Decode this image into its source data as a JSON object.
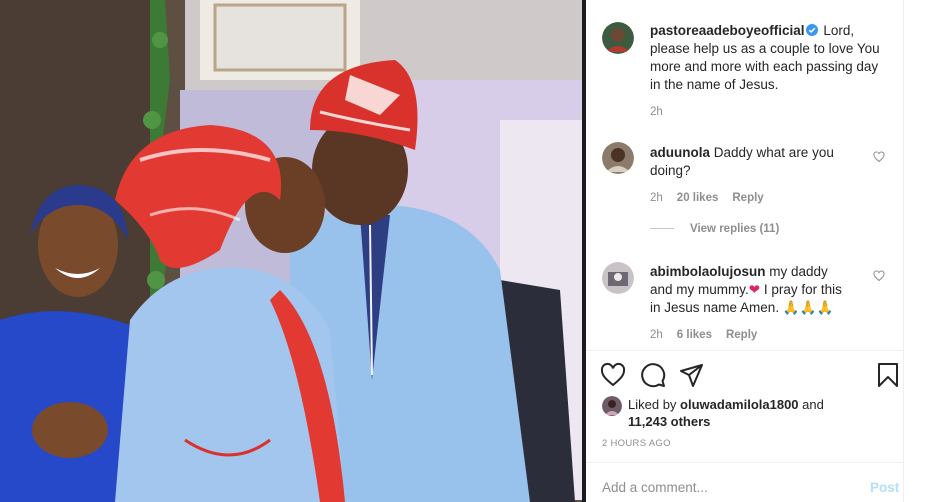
{
  "photo": {
    "alt": "photo",
    "colors": {
      "dress_blue": "#9cc0ea",
      "gele_red": "#e23a33",
      "background": "#6a5a4c"
    }
  },
  "caption": {
    "username": "pastoreaadeboyeofficial",
    "verified": true,
    "text": "Lord, please help us as a couple to love You more and more with each passing day in the name of Jesus.",
    "time": "2h"
  },
  "comments": [
    {
      "username": "aduunola",
      "text": "Daddy what are you doing?",
      "time": "2h",
      "likes": "20 likes",
      "reply": "Reply"
    },
    {
      "username": "abimbolaolujosun",
      "text_before": "my daddy and my mummy.",
      "emoji_heart": "❤",
      "text_after": " I pray for this in Jesus name Amen. ",
      "emoji_pray": "🙏🙏🙏",
      "time": "2h",
      "likes": "6 likes",
      "reply": "Reply"
    }
  ],
  "view_replies": "View replies (11)",
  "actions": {
    "icons": [
      "heart-icon",
      "comment-icon",
      "share-icon",
      "bookmark-icon"
    ]
  },
  "likes": {
    "prefix": "Liked by ",
    "user": "oluwadamilola1800",
    "middle": " and",
    "count": "11,243 others"
  },
  "timeago": "2 HOURS AGO",
  "add_comment": {
    "placeholder": "Add a comment...",
    "post": "Post"
  },
  "theme": {
    "text": "#262626",
    "muted": "#8e8e8e",
    "link_disabled": "#b2dffc",
    "verified": "#3897f0"
  }
}
